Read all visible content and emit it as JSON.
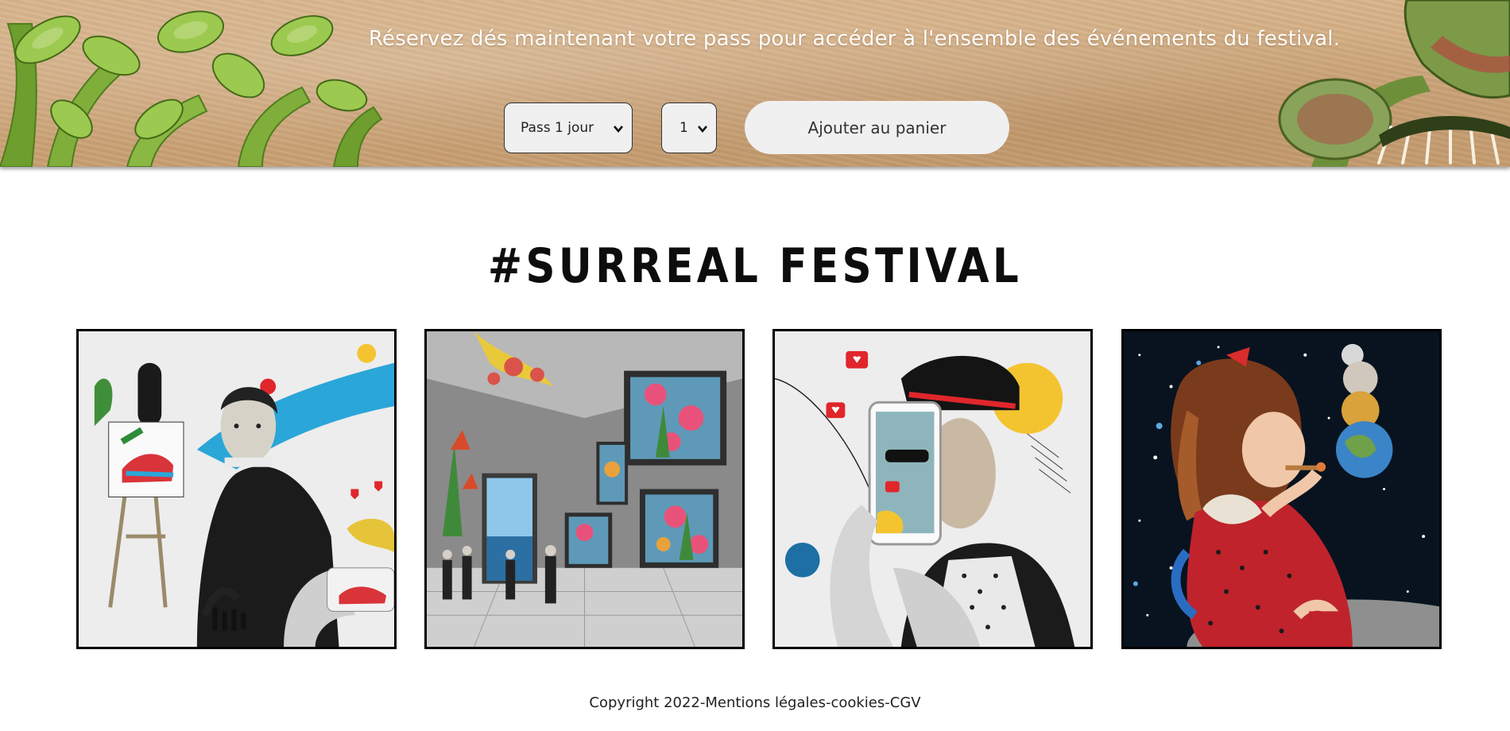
{
  "banner": {
    "text": "Réservez dés maintenant votre pass pour accéder à l'ensemble des événements du festival.",
    "pass_select": {
      "selected": "Pass 1 jour"
    },
    "quantity_select": {
      "selected": "1"
    },
    "cart_button_label": "Ajouter au panier"
  },
  "main": {
    "title": "#SURREAL FESTIVAL"
  },
  "footer": {
    "copyright": "Copyright 2022-Mentions légales-cookies-CGV"
  },
  "colors": {
    "banner_bg": "#cfa77b",
    "control_bg": "#f0f0f0",
    "frame_border": "#000000"
  },
  "icons": {
    "select_chevron": "chevron-down-icon"
  }
}
